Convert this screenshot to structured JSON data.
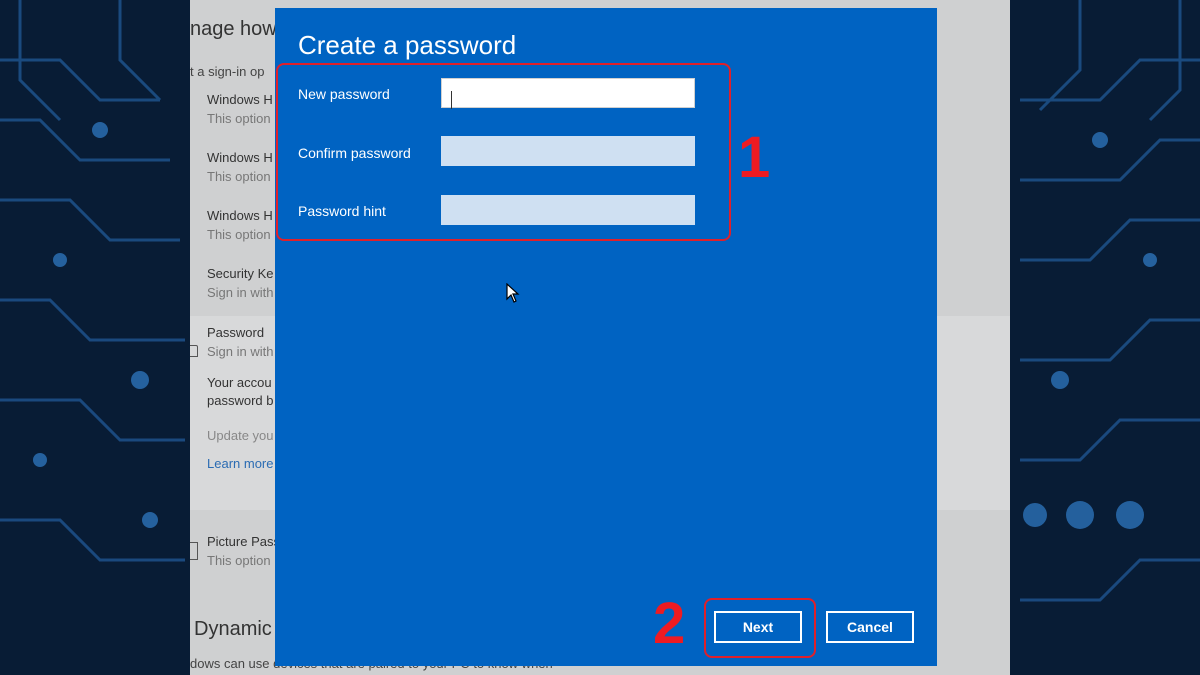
{
  "settings": {
    "heading": "nage how",
    "sub": "t a sign-in op",
    "options": [
      {
        "title": "Windows H",
        "desc": "This option"
      },
      {
        "title": "Windows H",
        "desc": "This option"
      },
      {
        "title": "Windows H",
        "desc": "This option"
      },
      {
        "title": "Security Ke",
        "desc": "Sign in with"
      },
      {
        "title": "Password",
        "desc": "Sign in with"
      }
    ],
    "password_desc_1": "Your accou",
    "password_desc_2": "password b",
    "update": "Update you",
    "learn_more": "Learn more",
    "picture_option": {
      "title": "Picture Pass",
      "desc": "This option"
    },
    "dynamic_heading": "Dynamic",
    "bottom_text": "dows can use devices that are paired to your PC to know when"
  },
  "dialog": {
    "title": "Create a password",
    "fields": [
      {
        "label": "New password",
        "value": ""
      },
      {
        "label": "Confirm password",
        "value": ""
      },
      {
        "label": "Password hint",
        "value": ""
      }
    ],
    "next_label": "Next",
    "cancel_label": "Cancel"
  },
  "annotations": {
    "step1": "1",
    "step2": "2",
    "color": "#ee1b22"
  },
  "colors": {
    "dialog_bg": "#0063c2",
    "settings_bg": "#cfd0d1"
  }
}
